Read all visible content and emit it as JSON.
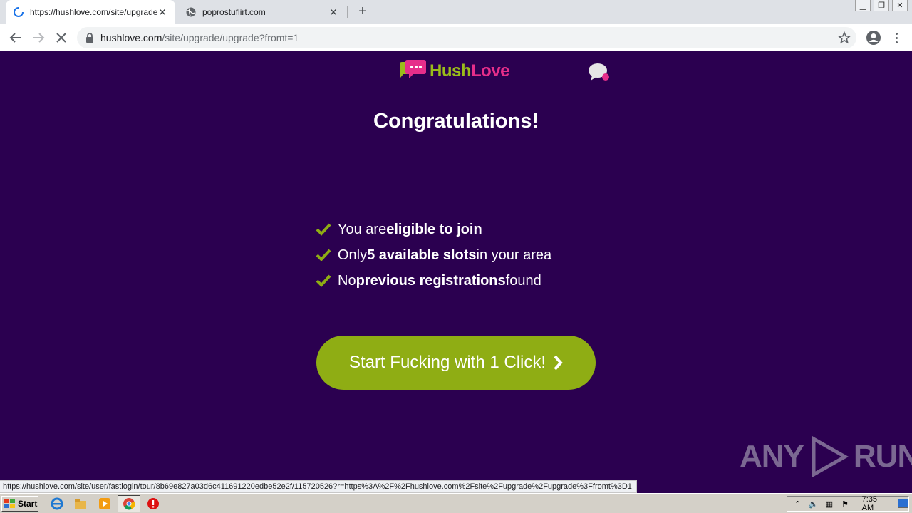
{
  "browser": {
    "tabs": [
      {
        "title": "https://hushlove.com/site/upgrade/u",
        "active": true,
        "loading": true,
        "icon": "spinner-icon"
      },
      {
        "title": "poprostuflirt.com",
        "active": false,
        "icon": "globe-icon"
      }
    ],
    "url_host": "hushlove.com",
    "url_path": "/site/upgrade/upgrade?fromt=1"
  },
  "page": {
    "logo": {
      "part1": "Hush",
      "part2": "Love"
    },
    "headline": "Congratulations!",
    "checks": [
      {
        "pre": "You are ",
        "bold": "eligible to join",
        "post": ""
      },
      {
        "pre": "Only ",
        "bold": "5 available slots",
        "post": " in your area"
      },
      {
        "pre": "No ",
        "bold": "previous registrations",
        "post": " found"
      }
    ],
    "cta_label": "Start Fucking with 1 Click!",
    "watermark": {
      "left": "ANY",
      "right": "RUN"
    }
  },
  "status_url": "https://hushlove.com/site/user/fastlogin/tour/8b69e827a03d6c411691220edbe52e2f/115720526?r=https%3A%2F%2Fhushlove.com%2Fsite%2Fupgrade%2Fupgrade%3Ffromt%3D1",
  "taskbar": {
    "start_label": "Start",
    "clock": "7:35 AM"
  },
  "colors": {
    "page_bg": "#2b0050",
    "cta_green": "#8fad14",
    "logo_green": "#9bbd1a",
    "logo_pink": "#e62e8a"
  }
}
